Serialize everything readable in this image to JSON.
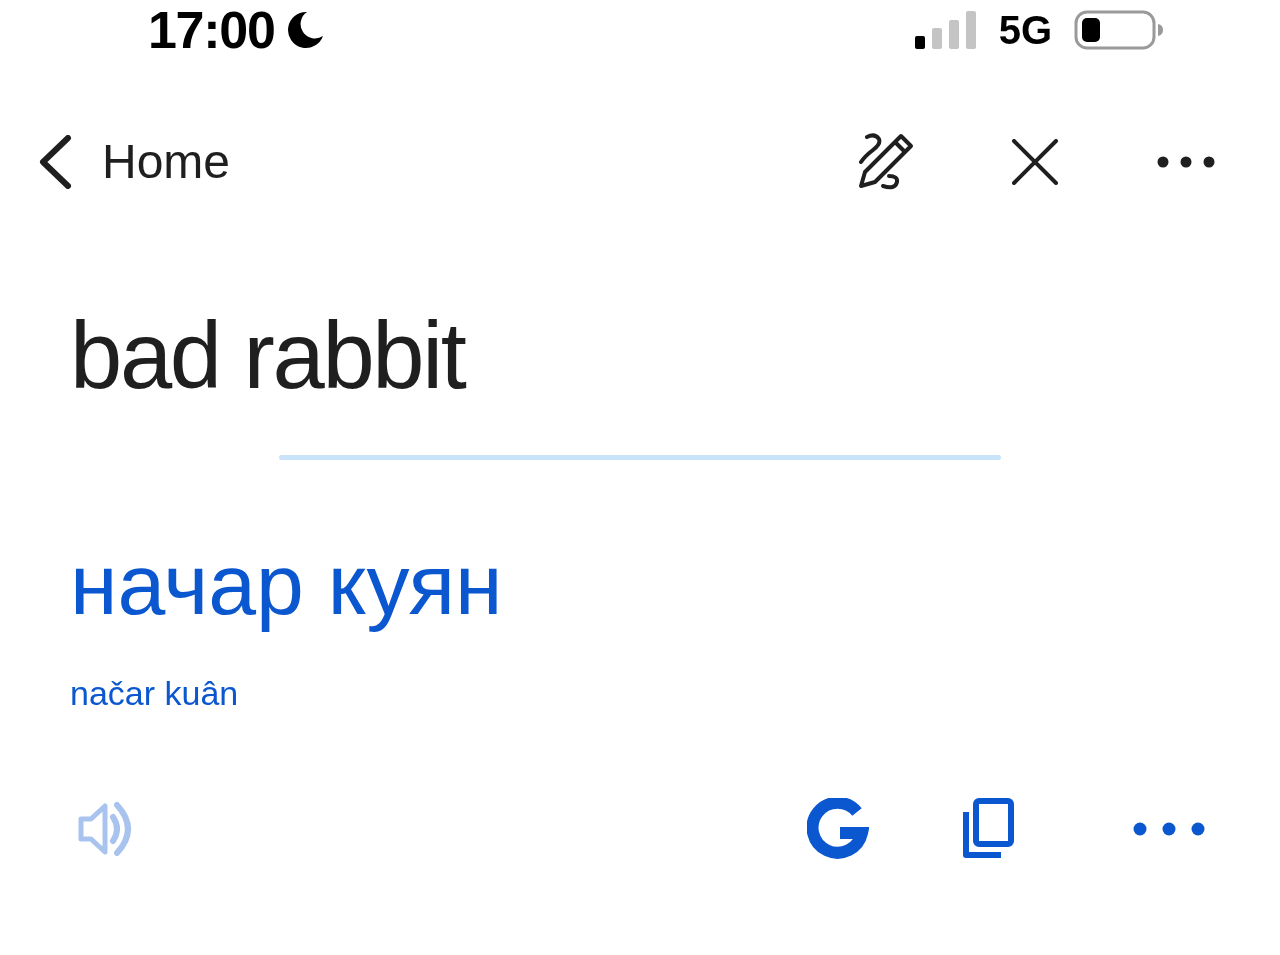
{
  "status_bar": {
    "time": "17:00",
    "network": "5G"
  },
  "nav": {
    "back_label": "Home"
  },
  "source": {
    "text": "bad rabbit"
  },
  "translation": {
    "text": "начар куян",
    "transliteration": "načar kuân"
  },
  "actions": {
    "speak": {
      "disabled": true
    }
  }
}
